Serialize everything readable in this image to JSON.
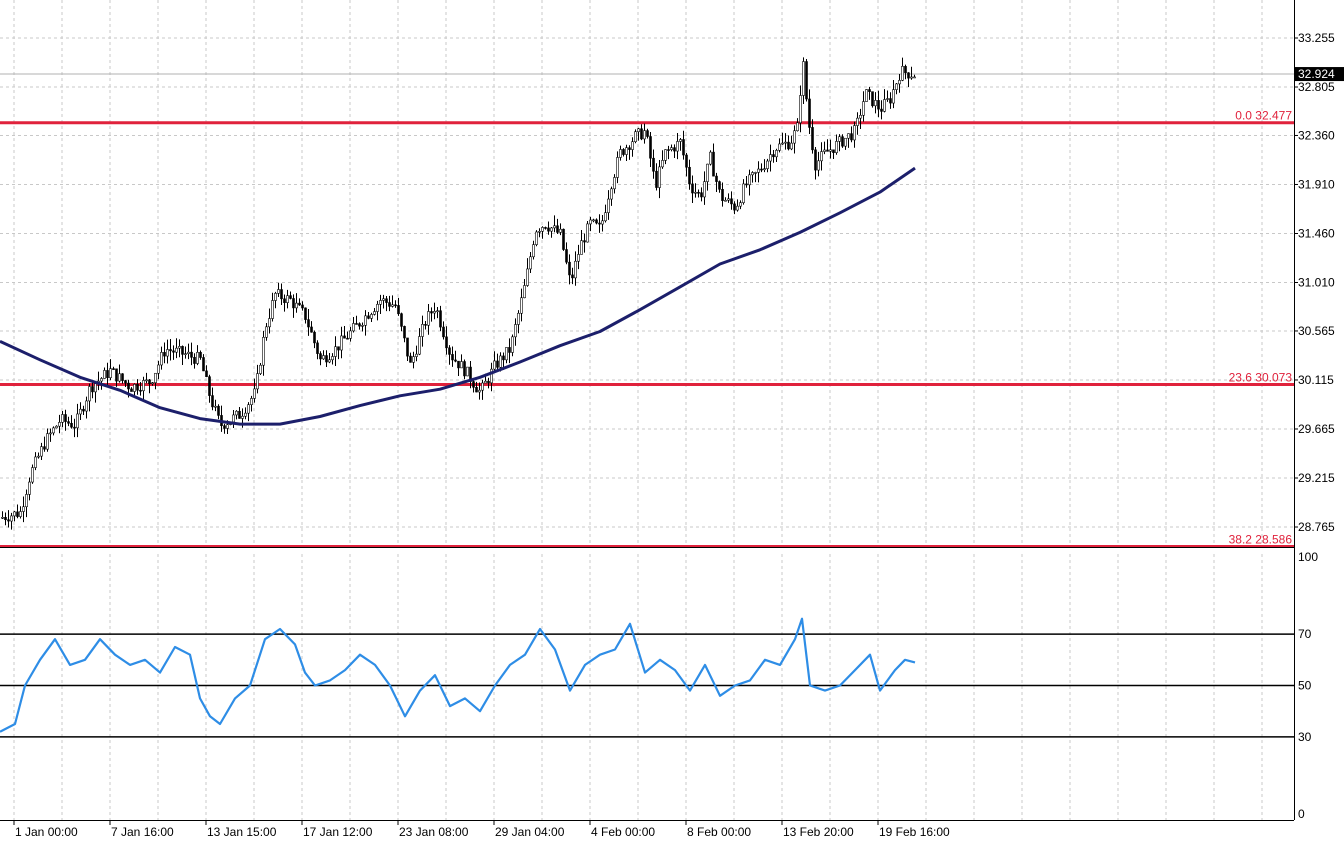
{
  "chart_data": [
    {
      "type": "candlestick",
      "panel": "price",
      "y_ticks": [
        "33.255",
        "32.805",
        "32.360",
        "31.910",
        "31.460",
        "31.010",
        "30.565",
        "30.115",
        "29.665",
        "29.215",
        "28.765"
      ],
      "ylim": [
        28.6,
        33.4
      ],
      "current_price": "32.924",
      "fibonacci_levels": [
        {
          "label": "0.0 32.477",
          "value": 32.477
        },
        {
          "label": "23.6 30.073",
          "value": 30.073
        },
        {
          "label": "38.2 28.586",
          "value": 28.586
        }
      ],
      "moving_average_points": [
        [
          0,
          30.47
        ],
        [
          40,
          30.3
        ],
        [
          80,
          30.14
        ],
        [
          120,
          30.02
        ],
        [
          160,
          29.86
        ],
        [
          200,
          29.76
        ],
        [
          240,
          29.71
        ],
        [
          280,
          29.71
        ],
        [
          320,
          29.78
        ],
        [
          360,
          29.88
        ],
        [
          400,
          29.97
        ],
        [
          440,
          30.03
        ],
        [
          480,
          30.14
        ],
        [
          520,
          30.28
        ],
        [
          560,
          30.43
        ],
        [
          600,
          30.56
        ],
        [
          640,
          30.76
        ],
        [
          680,
          30.97
        ],
        [
          720,
          31.18
        ],
        [
          760,
          31.31
        ],
        [
          800,
          31.47
        ],
        [
          840,
          31.65
        ],
        [
          880,
          31.84
        ],
        [
          915,
          32.06
        ]
      ],
      "candle_path": [
        [
          0,
          28.85
        ],
        [
          20,
          28.9
        ],
        [
          30,
          29.25
        ],
        [
          45,
          29.55
        ],
        [
          60,
          29.75
        ],
        [
          75,
          29.7
        ],
        [
          90,
          30.05
        ],
        [
          110,
          30.2
        ],
        [
          130,
          30.05
        ],
        [
          150,
          30.1
        ],
        [
          165,
          30.4
        ],
        [
          185,
          30.35
        ],
        [
          200,
          30.3
        ],
        [
          210,
          29.95
        ],
        [
          220,
          29.7
        ],
        [
          240,
          29.8
        ],
        [
          255,
          30.0
        ],
        [
          265,
          30.6
        ],
        [
          275,
          30.9
        ],
        [
          290,
          30.85
        ],
        [
          305,
          30.7
        ],
        [
          320,
          30.3
        ],
        [
          335,
          30.4
        ],
        [
          350,
          30.55
        ],
        [
          365,
          30.7
        ],
        [
          380,
          30.85
        ],
        [
          395,
          30.8
        ],
        [
          410,
          30.25
        ],
        [
          425,
          30.65
        ],
        [
          435,
          30.8
        ],
        [
          450,
          30.35
        ],
        [
          465,
          30.2
        ],
        [
          480,
          30.0
        ],
        [
          495,
          30.25
        ],
        [
          510,
          30.4
        ],
        [
          525,
          31.0
        ],
        [
          535,
          31.5
        ],
        [
          545,
          31.55
        ],
        [
          560,
          31.45
        ],
        [
          570,
          31.0
        ],
        [
          580,
          31.35
        ],
        [
          590,
          31.55
        ],
        [
          600,
          31.5
        ],
        [
          610,
          31.9
        ],
        [
          620,
          32.2
        ],
        [
          635,
          32.35
        ],
        [
          645,
          32.4
        ],
        [
          655,
          31.9
        ],
        [
          665,
          32.2
        ],
        [
          680,
          32.3
        ],
        [
          690,
          31.9
        ],
        [
          700,
          31.8
        ],
        [
          710,
          32.15
        ],
        [
          720,
          31.8
        ],
        [
          735,
          31.7
        ],
        [
          745,
          31.9
        ],
        [
          760,
          32.05
        ],
        [
          775,
          32.25
        ],
        [
          790,
          32.3
        ],
        [
          798,
          32.45
        ],
        [
          802,
          33.1
        ],
        [
          808,
          32.5
        ],
        [
          815,
          32.1
        ],
        [
          825,
          32.2
        ],
        [
          840,
          32.3
        ],
        [
          855,
          32.4
        ],
        [
          865,
          32.75
        ],
        [
          880,
          32.6
        ],
        [
          890,
          32.7
        ],
        [
          900,
          32.95
        ],
        [
          915,
          32.92
        ]
      ]
    },
    {
      "type": "line",
      "panel": "oscillator",
      "y_ticks": [
        "100",
        "70",
        "50",
        "30",
        "0"
      ],
      "reference_lines": [
        70,
        50,
        30
      ],
      "ylim": [
        0,
        100
      ],
      "points": [
        [
          0,
          32
        ],
        [
          15,
          35
        ],
        [
          25,
          50
        ],
        [
          40,
          60
        ],
        [
          55,
          68
        ],
        [
          70,
          58
        ],
        [
          85,
          60
        ],
        [
          100,
          68
        ],
        [
          115,
          62
        ],
        [
          130,
          58
        ],
        [
          145,
          60
        ],
        [
          160,
          55
        ],
        [
          175,
          65
        ],
        [
          190,
          62
        ],
        [
          200,
          45
        ],
        [
          210,
          38
        ],
        [
          220,
          35
        ],
        [
          235,
          45
        ],
        [
          250,
          50
        ],
        [
          265,
          68
        ],
        [
          280,
          72
        ],
        [
          295,
          66
        ],
        [
          305,
          55
        ],
        [
          315,
          50
        ],
        [
          330,
          52
        ],
        [
          345,
          56
        ],
        [
          360,
          62
        ],
        [
          375,
          58
        ],
        [
          390,
          50
        ],
        [
          405,
          38
        ],
        [
          420,
          48
        ],
        [
          435,
          54
        ],
        [
          450,
          42
        ],
        [
          465,
          45
        ],
        [
          480,
          40
        ],
        [
          495,
          50
        ],
        [
          510,
          58
        ],
        [
          525,
          62
        ],
        [
          540,
          72
        ],
        [
          555,
          64
        ],
        [
          570,
          48
        ],
        [
          585,
          58
        ],
        [
          600,
          62
        ],
        [
          615,
          64
        ],
        [
          630,
          74
        ],
        [
          645,
          55
        ],
        [
          660,
          60
        ],
        [
          675,
          56
        ],
        [
          690,
          48
        ],
        [
          705,
          58
        ],
        [
          720,
          46
        ],
        [
          735,
          50
        ],
        [
          750,
          52
        ],
        [
          765,
          60
        ],
        [
          780,
          58
        ],
        [
          795,
          68
        ],
        [
          802,
          76
        ],
        [
          810,
          50
        ],
        [
          825,
          48
        ],
        [
          840,
          50
        ],
        [
          855,
          56
        ],
        [
          870,
          62
        ],
        [
          880,
          48
        ],
        [
          895,
          56
        ],
        [
          905,
          60
        ],
        [
          915,
          59
        ]
      ]
    }
  ],
  "x_axis": {
    "labels": [
      "1 Jan 00:00",
      "7 Jan 16:00",
      "13 Jan 15:00",
      "17 Jan 12:00",
      "23 Jan 08:00",
      "29 Jan 04:00",
      "4 Feb 00:00",
      "8 Feb 00:00",
      "13 Feb 20:00",
      "19 Feb 16:00"
    ]
  },
  "colors": {
    "background": "#ffffff",
    "grid": "#c8c8c8",
    "candle": "#000000",
    "moving_average": "#1c1f6b",
    "fibonacci": "#e0223c",
    "oscillator": "#2e8de6",
    "price_box": "#000000"
  }
}
